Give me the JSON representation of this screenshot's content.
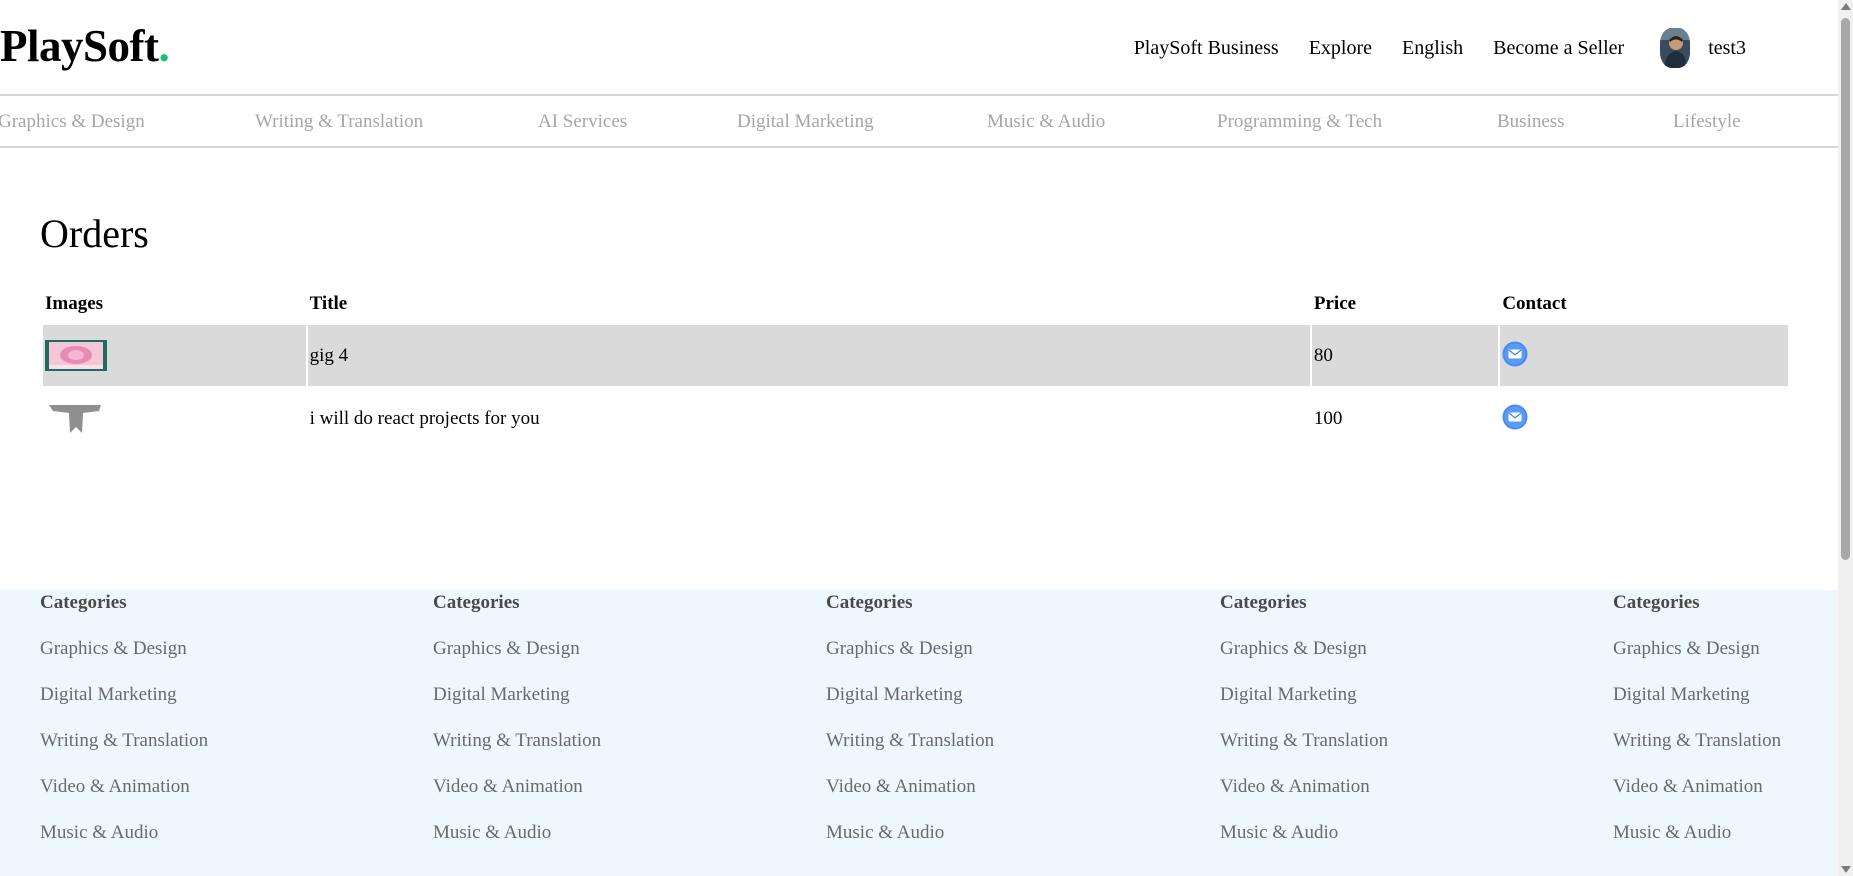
{
  "brand": {
    "name": "PlaySoft",
    "dot": ".",
    "dot_color": "#1dbf73"
  },
  "nav": {
    "business": "PlaySoft Business",
    "explore": "Explore",
    "language": "English",
    "become_seller": "Become a Seller",
    "username": "test3"
  },
  "menu": [
    "Graphics & Design",
    "Writing & Translation",
    "AI Services",
    "Digital Marketing",
    "Music & Audio",
    "Programming & Tech",
    "Business",
    "Lifestyle"
  ],
  "orders": {
    "title": "Orders",
    "columns": [
      "Images",
      "Title",
      "Price",
      "Contact"
    ],
    "rows": [
      {
        "title": "gig 4",
        "price": "80",
        "image_icon": "pink-flower-thumbnail",
        "contact_icon": "mail-icon"
      },
      {
        "title": "i will do react projects for you",
        "price": "100",
        "image_icon": "gray-figure-thumbnail",
        "contact_icon": "mail-icon"
      }
    ]
  },
  "footer": {
    "columns": [
      {
        "heading": "Categories",
        "items": [
          "Graphics & Design",
          "Digital Marketing",
          "Writing & Translation",
          "Video & Animation",
          "Music & Audio"
        ]
      },
      {
        "heading": "Categories",
        "items": [
          "Graphics & Design",
          "Digital Marketing",
          "Writing & Translation",
          "Video & Animation",
          "Music & Audio"
        ]
      },
      {
        "heading": "Categories",
        "items": [
          "Graphics & Design",
          "Digital Marketing",
          "Writing & Translation",
          "Video & Animation",
          "Music & Audio"
        ]
      },
      {
        "heading": "Categories",
        "items": [
          "Graphics & Design",
          "Digital Marketing",
          "Writing & Translation",
          "Video & Animation",
          "Music & Audio"
        ]
      },
      {
        "heading": "Categories",
        "items": [
          "Graphics & Design",
          "Digital Marketing",
          "Writing & Translation",
          "Video & Animation",
          "Music & Audio"
        ]
      }
    ]
  },
  "colors": {
    "accent": "#1dbf73",
    "row_highlight": "#dadada",
    "footer_bg": "#eef7fc",
    "menu_text": "#a6a6a6",
    "mail_blue": "#4a8af4"
  }
}
